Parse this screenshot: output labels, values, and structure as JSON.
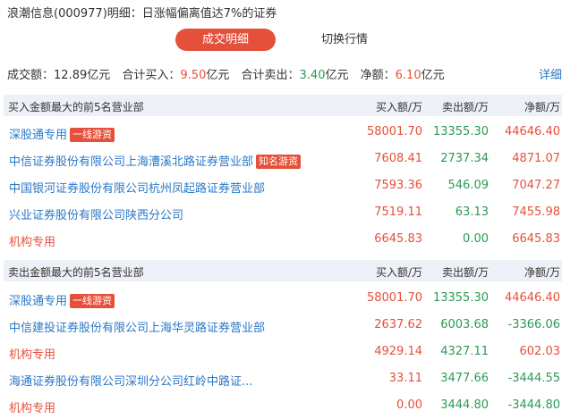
{
  "title": "浪潮信息(000977)明细：日涨幅偏离值达7%的证券",
  "tabs": [
    {
      "label": "成交明细",
      "active": true
    },
    {
      "label": "切换行情",
      "active": false
    }
  ],
  "summary": {
    "turnover_label": "成交额：",
    "turnover_value": "12.89",
    "turnover_unit": "亿元",
    "buy_label": "合计买入：",
    "buy_value": "9.50",
    "buy_unit": "亿元",
    "sell_label": "合计卖出：",
    "sell_value": "3.40",
    "sell_unit": "亿元",
    "net_label": "净额：",
    "net_value": "6.10",
    "net_unit": "亿元"
  },
  "detail_link": "详细",
  "buy_section": {
    "header": "买入金额最大的前5名营业部",
    "columns": [
      "买入额/万",
      "卖出额/万",
      "净额/万"
    ],
    "rows": [
      {
        "name": "深股通专用",
        "badge": "一线游资",
        "institution": false,
        "buy": "58001.70",
        "sell": "13355.30",
        "net": "44646.40",
        "net_sign": "pos"
      },
      {
        "name": "中信证券股份有限公司上海漕溪北路证券营业部",
        "badge": "知名游资",
        "institution": false,
        "buy": "7608.41",
        "sell": "2737.34",
        "net": "4871.07",
        "net_sign": "pos"
      },
      {
        "name": "中国银河证券股份有限公司杭州凤起路证券营业部",
        "badge": "",
        "institution": false,
        "buy": "7593.36",
        "sell": "546.09",
        "net": "7047.27",
        "net_sign": "pos"
      },
      {
        "name": "兴业证券股份有限公司陕西分公司",
        "badge": "",
        "institution": false,
        "buy": "7519.11",
        "sell": "63.13",
        "net": "7455.98",
        "net_sign": "pos"
      },
      {
        "name": "机构专用",
        "badge": "",
        "institution": true,
        "buy": "6645.83",
        "sell": "0.00",
        "net": "6645.83",
        "net_sign": "pos"
      }
    ]
  },
  "sell_section": {
    "header": "卖出金额最大的前5名营业部",
    "columns": [
      "买入额/万",
      "卖出额/万",
      "净额/万"
    ],
    "rows": [
      {
        "name": "深股通专用",
        "badge": "一线游资",
        "institution": false,
        "buy": "58001.70",
        "sell": "13355.30",
        "net": "44646.40",
        "net_sign": "pos"
      },
      {
        "name": "中信建投证券股份有限公司上海华灵路证券营业部",
        "badge": "",
        "institution": false,
        "buy": "2637.62",
        "sell": "6003.68",
        "net": "-3366.06",
        "net_sign": "neg"
      },
      {
        "name": "机构专用",
        "badge": "",
        "institution": true,
        "buy": "4929.14",
        "sell": "4327.11",
        "net": "602.03",
        "net_sign": "pos"
      },
      {
        "name": "海通证券股份有限公司深圳分公司红岭中路证...",
        "badge": "",
        "institution": false,
        "buy": "33.11",
        "sell": "3477.66",
        "net": "-3444.55",
        "net_sign": "neg"
      },
      {
        "name": "机构专用",
        "badge": "",
        "institution": true,
        "buy": "0.00",
        "sell": "3444.80",
        "net": "-3444.80",
        "net_sign": "neg"
      }
    ]
  },
  "colors": {
    "red": "#e5503b",
    "green": "#2b9a55",
    "blue": "#2a78c8",
    "header_bg": "#edf0f7"
  }
}
